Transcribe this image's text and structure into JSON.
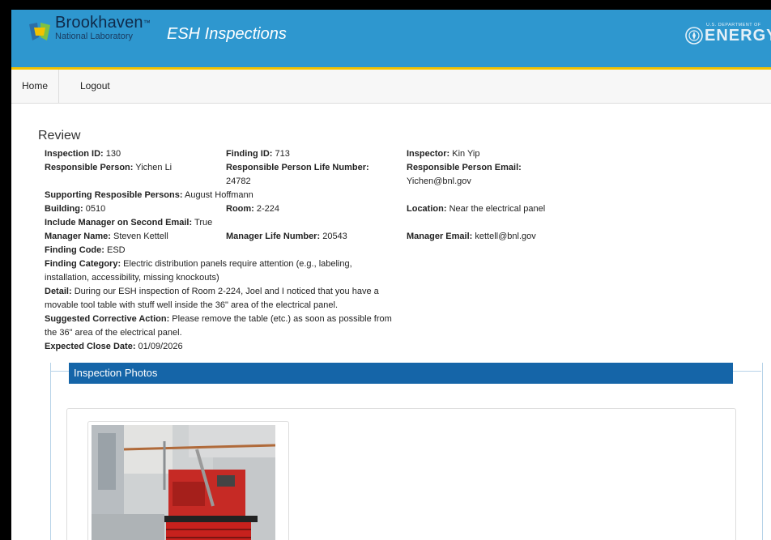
{
  "header": {
    "brand_name": "Brookhaven",
    "brand_tm": "™",
    "brand_sub": "National Laboratory",
    "app_title": "ESH Inspections",
    "doe_small": "U.S. DEPARTMENT OF",
    "doe_big": "ENERGY"
  },
  "nav": {
    "home": "Home",
    "logout": "Logout"
  },
  "review": {
    "title": "Review",
    "inspection_id_label": "Inspection ID:",
    "inspection_id": "130",
    "finding_id_label": "Finding ID:",
    "finding_id": "713",
    "inspector_label": "Inspector:",
    "inspector": "Kin Yip",
    "responsible_person_label": "Responsible Person:",
    "responsible_person": "Yichen Li",
    "rp_life_number_label": "Responsible Person Life Number:",
    "rp_life_number": "24782",
    "rp_email_label": "Responsible Person Email:",
    "rp_email": "Yichen@bnl.gov",
    "supporting_label": "Supporting Resposible Persons:",
    "supporting": "August Hoffmann",
    "building_label": "Building:",
    "building": "0510",
    "room_label": "Room:",
    "room": "2-224",
    "location_label": "Location:",
    "location": "Near the electrical panel",
    "include_manager_label": "Include Manager on Second Email:",
    "include_manager": "True",
    "manager_name_label": "Manager Name:",
    "manager_name": "Steven Kettell",
    "manager_life_label": "Manager Life Number:",
    "manager_life": "20543",
    "manager_email_label": "Manager Email:",
    "manager_email": "kettell@bnl.gov",
    "finding_code_label": "Finding Code:",
    "finding_code": "ESD",
    "finding_category_label": "Finding Category:",
    "finding_category_1": "Electric distribution panels require attention (e.g., labeling,",
    "finding_category_2": "installation, accessibility, missing knockouts)",
    "detail_label": "Detail:",
    "detail_1": "During our ESH inspection of Room 2-224, Joel and I noticed that you have a",
    "detail_2": "movable tool table with stuff well inside the 36\" area of the electrical panel.",
    "corrective_label": "Suggested Corrective Action:",
    "corrective_1": "Please remove the table (etc.) as soon as possible from",
    "corrective_2": "the 36\" area of the electrical panel.",
    "close_date_label": "Expected Close Date:",
    "close_date": "01/09/2026"
  },
  "photos": {
    "heading": "Inspection Photos"
  },
  "colors": {
    "header_bg": "#2e97cf",
    "header_accent": "#f2c200",
    "section_head": "#1565a8"
  }
}
